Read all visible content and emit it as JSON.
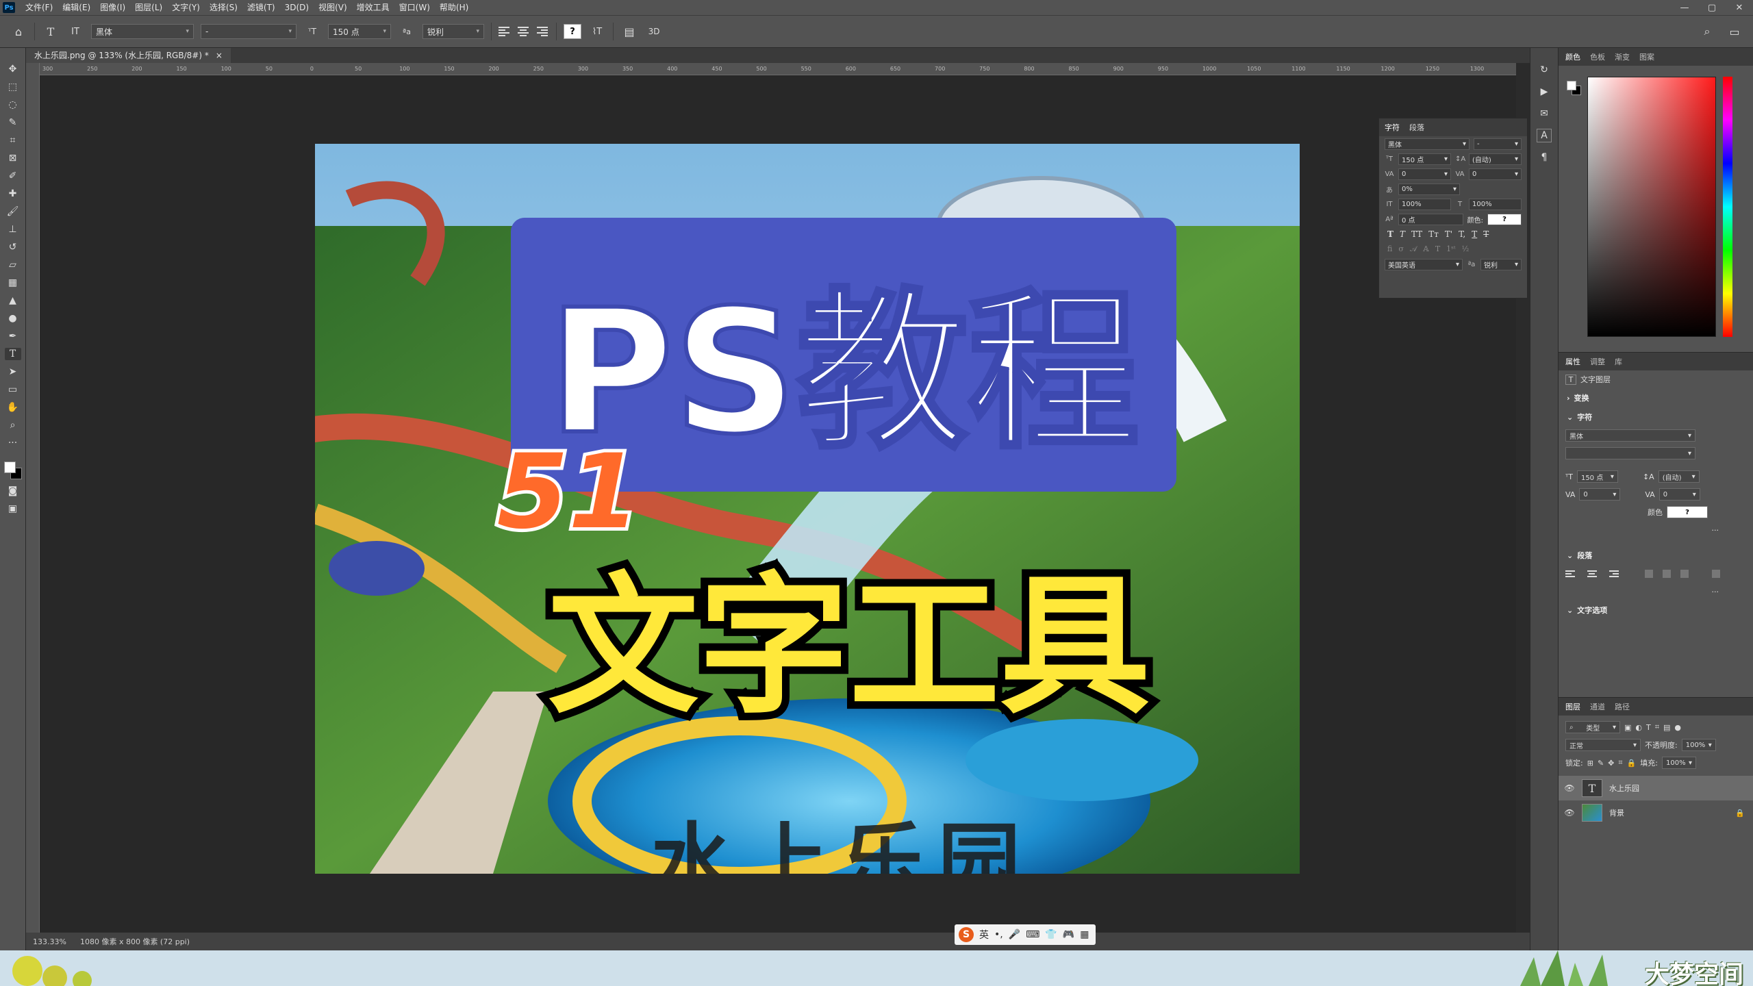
{
  "menubar": {
    "items": [
      "文件(F)",
      "编辑(E)",
      "图像(I)",
      "图层(L)",
      "文字(Y)",
      "选择(S)",
      "滤镜(T)",
      "3D(D)",
      "视图(V)",
      "增效工具",
      "窗口(W)",
      "帮助(H)"
    ],
    "app_icon": "Ps",
    "minimize": "—",
    "maximize": "▢",
    "close": "✕"
  },
  "options": {
    "font_family": "黑体",
    "font_style": "-",
    "font_size": "150 点",
    "aa_mode": "锐利",
    "threed_label": "3D",
    "color_swatch_label": "?"
  },
  "document": {
    "tab_title": "水上乐园.png @ 133% (水上乐园, RGB/8#) *",
    "tab_close": "×",
    "zoom": "133.33%",
    "size_info": "1080 像素 x 800 像素 (72 ppi)"
  },
  "ruler_labels": [
    "300",
    "250",
    "200",
    "150",
    "100",
    "50",
    "0",
    "50",
    "100",
    "150",
    "200",
    "250",
    "300",
    "350",
    "400",
    "450",
    "500",
    "550",
    "600",
    "650",
    "700",
    "750",
    "800",
    "850",
    "900",
    "950",
    "1000",
    "1050",
    "1100",
    "1150",
    "1200",
    "1250",
    "1300"
  ],
  "artwork": {
    "title": "PS教程",
    "episode": "51",
    "subtitle": "文字工具",
    "background_text": "水上乐园"
  },
  "char_panel": {
    "tabs": [
      "字符",
      "段落"
    ],
    "font_family": "黑体",
    "font_style": "-",
    "size": "150 点",
    "leading": "(自动)",
    "kerning": "0",
    "tracking": "0",
    "scale_percent": "0%",
    "vscale": "100%",
    "hscale": "100%",
    "baseline": "0 点",
    "color_label": "颜色:",
    "color_value": "?",
    "language": "美国英语",
    "aa_prefix": "ªa",
    "aa_mode": "锐利",
    "style_buttons": [
      "T",
      "T",
      "TT",
      "Tт",
      "T'",
      "T,",
      "T",
      "T"
    ]
  },
  "color_panel": {
    "tabs": [
      "颜色",
      "色板",
      "渐变",
      "图案"
    ]
  },
  "props_panel": {
    "tabs": [
      "属性",
      "调整",
      "库"
    ],
    "layer_type": "文字图层",
    "transform_label": "变换",
    "char_label": "字符",
    "font_family": "黑体",
    "font_style": "",
    "size": "150 点",
    "leading": "(自动)",
    "kerning": "0",
    "tracking": "0",
    "color_label": "颜色",
    "color_value": "?",
    "paragraph_label": "段落",
    "text_options_label": "文字选项",
    "more": "···"
  },
  "layers_panel": {
    "tabs": [
      "图层",
      "通道",
      "路径"
    ],
    "filter_kind": "类型",
    "blend_mode": "正常",
    "opacity_label": "不透明度:",
    "opacity": "100%",
    "lock_label": "锁定:",
    "fill_label": "填充:",
    "fill": "100%",
    "layers": [
      {
        "name": "水上乐园",
        "type": "text"
      },
      {
        "name": "背景",
        "type": "image"
      }
    ]
  },
  "ime": {
    "logo": "S",
    "mode": "英"
  },
  "branding": {
    "watermark": "大梦空间"
  },
  "colors": {
    "title_fill": "#ffffff",
    "title_bg": "#4a57c2",
    "subtitle_fill": "#ffe83a",
    "episode_fill": "#ff6a2a"
  }
}
